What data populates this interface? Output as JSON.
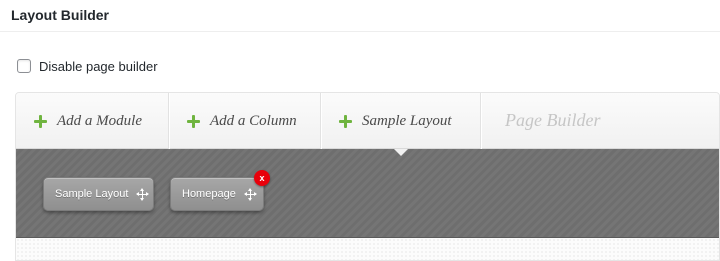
{
  "panel": {
    "title": "Layout Builder"
  },
  "options": {
    "disable_label": "Disable page builder",
    "disable_checked": false
  },
  "toolbar": {
    "items": [
      {
        "label": "Add a Module",
        "icon": "plus-icon"
      },
      {
        "label": "Add a Column",
        "icon": "plus-icon"
      },
      {
        "label": "Sample Layout",
        "icon": "plus-icon"
      }
    ],
    "title": "Page Builder"
  },
  "layout_tabs": [
    {
      "label": "Sample Layout",
      "icon": "move-icon"
    },
    {
      "label": "Homepage",
      "icon": "move-icon",
      "remove_label": "x"
    }
  ],
  "colors": {
    "accent_plus": "#6fb43f",
    "canvas_bg": "#6e6e6e",
    "remove_badge": "#e8000b"
  }
}
